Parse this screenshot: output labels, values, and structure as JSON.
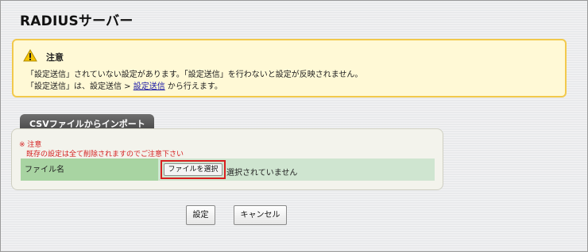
{
  "page": {
    "title": "RADIUSサーバー"
  },
  "notice": {
    "icon": "warning-icon",
    "title": "注意",
    "line1": "「設定送信」されていない設定があります。「設定送信」を行わないと設定が反映されません。",
    "line2_prefix": "「設定送信」は、設定送信 > ",
    "line2_link": "設定送信",
    "line2_suffix": " から行えます。",
    "colors": {
      "background": "#fff9d6",
      "border": "#f2c94c"
    }
  },
  "import_section": {
    "tab_label": "CSVファイルからインポート",
    "note_title": "※ 注意",
    "note_text": "既存の設定は全て削除されますのでご注意下さい",
    "file_row": {
      "label": "ファイル名",
      "button_label": "ファイルを選択",
      "status": "選択されていません"
    },
    "colors": {
      "note": "#d42020",
      "label_cell": "#a8d4a2",
      "value_cell": "#cfe5d0",
      "highlight": "#d81f1f"
    }
  },
  "actions": {
    "save_label": "設定",
    "cancel_label": "キャンセル"
  }
}
